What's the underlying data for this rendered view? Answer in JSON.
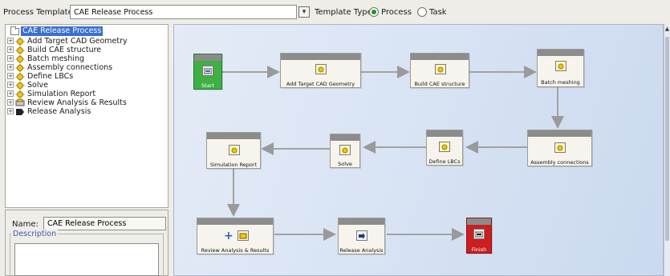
{
  "toolbar": {
    "template_label": "Process Template",
    "template_value": "CAE Release Process",
    "type_label": "Template Type",
    "options": [
      {
        "label": "Process",
        "selected": true
      },
      {
        "label": "Task",
        "selected": false
      }
    ]
  },
  "tree": {
    "root": "CAE Release Process",
    "items": [
      {
        "label": "Add Target CAD Geometry",
        "icon": "task-icon"
      },
      {
        "label": "Build CAE structure",
        "icon": "task-icon"
      },
      {
        "label": "Batch meshing",
        "icon": "task-icon"
      },
      {
        "label": "Assembly connections",
        "icon": "task-icon"
      },
      {
        "label": "Define LBCs",
        "icon": "task-icon"
      },
      {
        "label": "Solve",
        "icon": "task-icon"
      },
      {
        "label": "Simulation Report",
        "icon": "task-icon"
      },
      {
        "label": "Review Analysis & Results",
        "icon": "review-icon"
      },
      {
        "label": "Release Analysis",
        "icon": "release-icon"
      }
    ]
  },
  "properties": {
    "name_label": "Name:",
    "name_value": "CAE Release Process",
    "description_label": "Description"
  },
  "workflow": {
    "nodes": {
      "start": "Start",
      "add_target": "Add Target CAD Geometry",
      "build_cae": "Build CAE structure",
      "batch_meshing": "Batch meshing",
      "assembly": "Assembly connections",
      "define_lbcs": "Define LBCs",
      "solve": "Solve",
      "sim_report": "Simulation Report",
      "review": "Review Analysis & Results",
      "release": "Release Analysis",
      "finish": "Finish"
    }
  },
  "colors": {
    "start_fill": "#3fb043",
    "finish_fill": "#cc1e1e",
    "selection": "#3b6fd1",
    "node_header": "#8c8c8c",
    "radio_on": "#1c9a1c"
  }
}
